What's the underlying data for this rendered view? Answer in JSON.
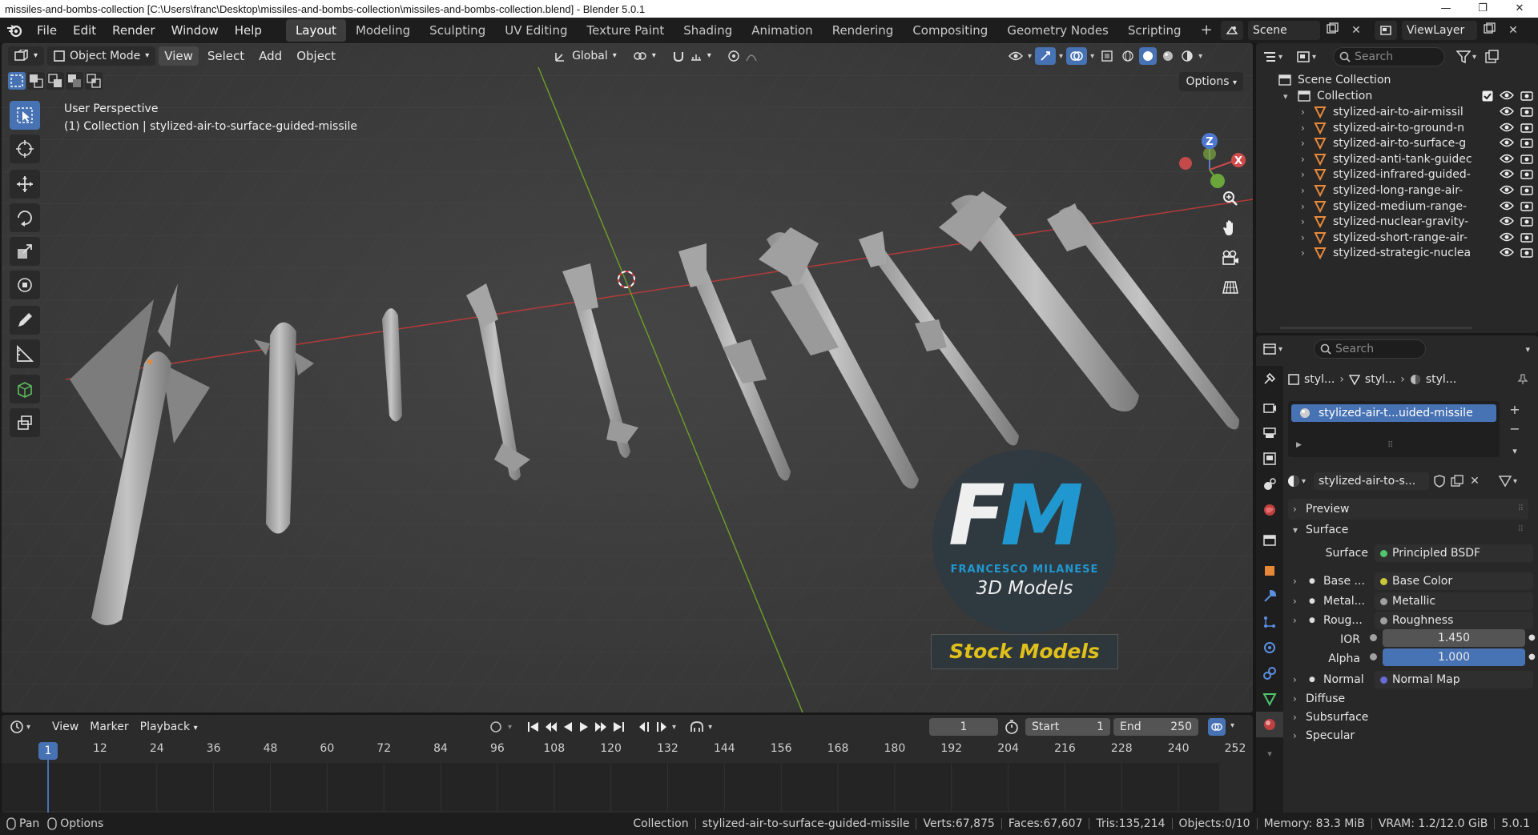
{
  "window": {
    "title": "missiles-and-bombs-collection [C:\\Users\\franc\\Desktop\\missiles-and-bombs-collection\\missiles-and-bombs-collection.blend] - Blender 5.0.1",
    "minimize": "—",
    "maximize": "❐",
    "close": "✕"
  },
  "menu": [
    "File",
    "Edit",
    "Render",
    "Window",
    "Help"
  ],
  "workspaces": [
    "Layout",
    "Modeling",
    "Sculpting",
    "UV Editing",
    "Texture Paint",
    "Shading",
    "Animation",
    "Rendering",
    "Compositing",
    "Geometry Nodes",
    "Scripting"
  ],
  "add_workspace": "+",
  "scene": {
    "name": "Scene",
    "view_layer": "ViewLayer"
  },
  "viewport": {
    "mode": "Object Mode",
    "menus": [
      "View",
      "Select",
      "Add",
      "Object"
    ],
    "transform_orientation": "Global",
    "options": "Options",
    "info_line1": "User Perspective",
    "info_line2": "(1) Collection | stylized-air-to-surface-guided-missile",
    "gizmo": {
      "z": "Z",
      "x": "X"
    }
  },
  "watermark": {
    "logo_text": "FM",
    "brand": "FRANCESCO MILANESE",
    "tagline": "3D Models",
    "badge": "Stock Models"
  },
  "timeline": {
    "menus": [
      "View",
      "Marker",
      "Playback"
    ],
    "current_frame": "1",
    "start_label": "Start",
    "start": "1",
    "end_label": "End",
    "end": "250",
    "ticks": [
      "1",
      "12",
      "24",
      "36",
      "48",
      "60",
      "72",
      "84",
      "96",
      "108",
      "120",
      "132",
      "144",
      "156",
      "168",
      "180",
      "192",
      "204",
      "216",
      "228",
      "240",
      "252"
    ]
  },
  "statusbar": {
    "pan": "Pan",
    "options": "Options",
    "collection": "Collection",
    "object": "stylized-air-to-surface-guided-missile",
    "verts": "Verts:67,875",
    "faces": "Faces:67,607",
    "tris": "Tris:135,214",
    "objects": "Objects:0/10",
    "memory": "Memory: 83.3 MiB",
    "vram": "VRAM: 1.2/12.0 GiB",
    "version": "5.0.1"
  },
  "outliner": {
    "search_placeholder": "Search",
    "root": "Scene Collection",
    "collection": "Collection",
    "items": [
      "stylized-air-to-air-missil",
      "stylized-air-to-ground-n",
      "stylized-air-to-surface-g",
      "stylized-anti-tank-guidec",
      "stylized-infrared-guided-",
      "stylized-long-range-air-",
      "stylized-medium-range-",
      "stylized-nuclear-gravity-",
      "stylized-short-range-air-",
      "stylized-strategic-nuclea"
    ]
  },
  "properties": {
    "search_placeholder": "Search",
    "breadcrumb": [
      "styl...",
      "styl...",
      "styl..."
    ],
    "material_slot": "stylized-air-t...uided-missile",
    "material_name": "stylized-air-to-s...",
    "panels": {
      "preview": "Preview",
      "surface": "Surface",
      "diffuse": "Diffuse",
      "subsurface": "Subsurface",
      "specular": "Specular"
    },
    "surface_label": "Surface",
    "surface_shader": "Principled BSDF",
    "rows": [
      {
        "label": "Base ...",
        "value": "Base Color",
        "color": "#c8c83a"
      },
      {
        "label": "Metal...",
        "value": "Metallic",
        "color": "#a0a0a0"
      },
      {
        "label": "Roug...",
        "value": "Roughness",
        "color": "#a0a0a0"
      }
    ],
    "ior_label": "IOR",
    "ior": "1.450",
    "alpha_label": "Alpha",
    "alpha": "1.000",
    "normal_label": "Normal",
    "normal_value": "Normal Map"
  },
  "colors": {
    "accent": "#4772b3",
    "shader_green": "#4fc46b",
    "normal_purple": "#6a6ad6",
    "viewport_bg": "#3c3c3c",
    "object_orange": "#e8893a"
  }
}
